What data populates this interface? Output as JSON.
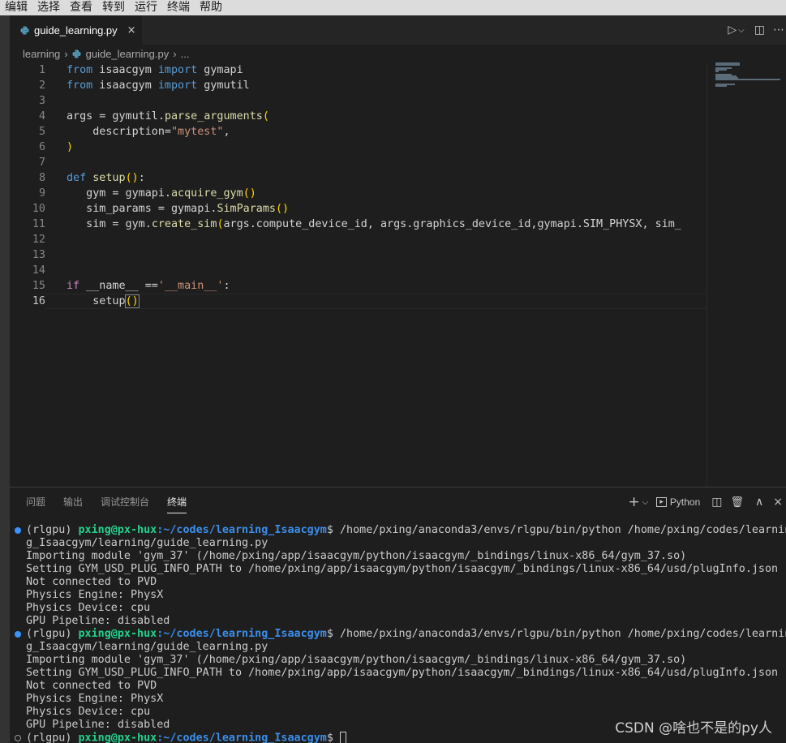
{
  "menubar": [
    "编辑",
    "选择",
    "查看",
    "转到",
    "运行",
    "终端",
    "帮助"
  ],
  "tab": {
    "label": "guide_learning.py",
    "close": "×"
  },
  "tabbar_actions": {
    "run": "▷",
    "run_dropdown": "⌵",
    "split": "◫",
    "more": "⋯"
  },
  "breadcrumb": {
    "folder": "learning",
    "sep": "›",
    "file": "guide_learning.py",
    "sep2": "›",
    "symbol": "..."
  },
  "editor": {
    "active_line": 16,
    "lines": [
      {
        "n": "1",
        "tokens": [
          [
            "kw",
            "from"
          ],
          [
            "plain",
            " isaacgym "
          ],
          [
            "kw",
            "import"
          ],
          [
            "plain",
            " gymapi"
          ]
        ]
      },
      {
        "n": "2",
        "tokens": [
          [
            "kw",
            "from"
          ],
          [
            "plain",
            " isaacgym "
          ],
          [
            "kw",
            "import"
          ],
          [
            "plain",
            " gymutil"
          ]
        ]
      },
      {
        "n": "3",
        "tokens": []
      },
      {
        "n": "4",
        "tokens": [
          [
            "plain",
            "args = gymutil."
          ],
          [
            "fn",
            "parse_arguments"
          ],
          [
            "br",
            "("
          ]
        ]
      },
      {
        "n": "5",
        "tokens": [
          [
            "plain",
            "    description="
          ],
          [
            "str",
            "\"mytest\""
          ],
          [
            "plain",
            ","
          ]
        ]
      },
      {
        "n": "6",
        "tokens": [
          [
            "br",
            ")"
          ]
        ]
      },
      {
        "n": "7",
        "tokens": []
      },
      {
        "n": "8",
        "tokens": [
          [
            "kw",
            "def"
          ],
          [
            "plain",
            " "
          ],
          [
            "fn",
            "setup"
          ],
          [
            "br",
            "()"
          ],
          [
            "plain",
            ":"
          ]
        ]
      },
      {
        "n": "9",
        "tokens": [
          [
            "plain",
            "   gym = gymapi."
          ],
          [
            "fn",
            "acquire_gym"
          ],
          [
            "br",
            "()"
          ]
        ]
      },
      {
        "n": "10",
        "tokens": [
          [
            "plain",
            "   sim_params = gymapi."
          ],
          [
            "fn",
            "SimParams"
          ],
          [
            "br",
            "()"
          ]
        ]
      },
      {
        "n": "11",
        "tokens": [
          [
            "plain",
            "   sim = gym."
          ],
          [
            "fn",
            "create_sim"
          ],
          [
            "br",
            "("
          ],
          [
            "plain",
            "args.compute_device_id, args.graphics_device_id,gymapi.SIM_PHYSX, sim_"
          ]
        ]
      },
      {
        "n": "12",
        "tokens": []
      },
      {
        "n": "13",
        "tokens": []
      },
      {
        "n": "14",
        "tokens": []
      },
      {
        "n": "15",
        "tokens": [
          [
            "kw2",
            "if"
          ],
          [
            "plain",
            " __name__ =="
          ],
          [
            "str",
            "'__main__'"
          ],
          [
            "plain",
            ":"
          ]
        ]
      },
      {
        "n": "16",
        "tokens": [
          [
            "plain",
            "    setup"
          ],
          [
            "brc",
            "()"
          ]
        ]
      }
    ]
  },
  "panel": {
    "tabs": [
      "问题",
      "输出",
      "调试控制台",
      "终端"
    ],
    "active_tab": 3,
    "actions": {
      "add": "+",
      "dropdown": "⌵",
      "shell_icon": "▸",
      "shell": "Python",
      "split": "◫",
      "trash": "🗑",
      "maximize": "∧",
      "close": "×"
    }
  },
  "terminal": {
    "lines": [
      {
        "dot": "blue",
        "env": "(rlgpu) ",
        "user": "pxing@px-hux",
        "path": ":~/codes/learning_Isaacgym",
        "rest": "$ /home/pxing/anaconda3/envs/rlgpu/bin/python /home/pxing/codes/learnin"
      },
      {
        "text": "g_Isaacgym/learning/guide_learning.py"
      },
      {
        "text": "Importing module 'gym_37' (/home/pxing/app/isaacgym/python/isaacgym/_bindings/linux-x86_64/gym_37.so)"
      },
      {
        "text": "Setting GYM_USD_PLUG_INFO_PATH to /home/pxing/app/isaacgym/python/isaacgym/_bindings/linux-x86_64/usd/plugInfo.json"
      },
      {
        "text": "Not connected to PVD"
      },
      {
        "text": "Physics Engine: PhysX"
      },
      {
        "text": "Physics Device: cpu"
      },
      {
        "text": "GPU Pipeline: disabled"
      },
      {
        "dot": "blue",
        "env": "(rlgpu) ",
        "user": "pxing@px-hux",
        "path": ":~/codes/learning_Isaacgym",
        "rest": "$ /home/pxing/anaconda3/envs/rlgpu/bin/python /home/pxing/codes/learnin"
      },
      {
        "text": "g_Isaacgym/learning/guide_learning.py"
      },
      {
        "text": "Importing module 'gym_37' (/home/pxing/app/isaacgym/python/isaacgym/_bindings/linux-x86_64/gym_37.so)"
      },
      {
        "text": "Setting GYM_USD_PLUG_INFO_PATH to /home/pxing/app/isaacgym/python/isaacgym/_bindings/linux-x86_64/usd/plugInfo.json"
      },
      {
        "text": "Not connected to PVD"
      },
      {
        "text": "Physics Engine: PhysX"
      },
      {
        "text": "Physics Device: cpu"
      },
      {
        "text": "GPU Pipeline: disabled"
      },
      {
        "dot": "hollow",
        "env": "(rlgpu) ",
        "user": "pxing@px-hux",
        "path": ":~/codes/learning_Isaacgym",
        "rest": "$ ",
        "cursor": true
      }
    ]
  },
  "watermark": "CSDN @啥也不是的py人",
  "colors": {
    "editor_bg": "#1e1e1e",
    "keyword": "#569cd6",
    "string": "#ce9178",
    "function": "#dcdcaa",
    "term_user": "#23d18b",
    "term_path": "#3b8eea"
  }
}
